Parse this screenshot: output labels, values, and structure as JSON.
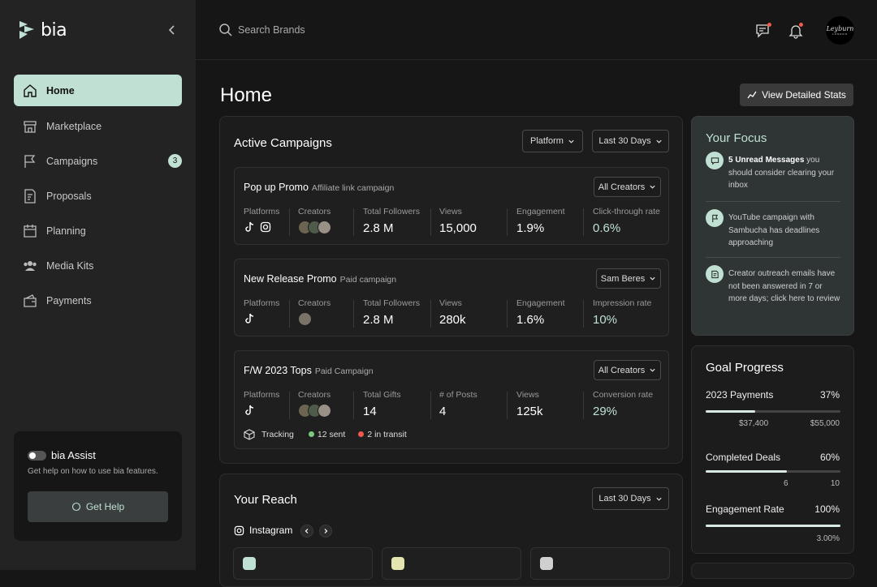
{
  "brand": {
    "name": "bia"
  },
  "sidebar": {
    "items": [
      {
        "label": "Home",
        "icon": "home-icon",
        "active": true
      },
      {
        "label": "Marketplace",
        "icon": "store-icon"
      },
      {
        "label": "Campaigns",
        "icon": "flag-icon",
        "badge": "3"
      },
      {
        "label": "Proposals",
        "icon": "document-edit-icon"
      },
      {
        "label": "Planning",
        "icon": "calendar-icon"
      },
      {
        "label": "Media Kits",
        "icon": "people-icon"
      },
      {
        "label": "Payments",
        "icon": "wallet-icon"
      }
    ],
    "assist": {
      "title": "bia Assist",
      "subtitle": "Get help on how to use bia features.",
      "button": "Get Help"
    }
  },
  "topbar": {
    "search_placeholder": "Search Brands",
    "avatar_text": "Leyburn",
    "avatar_sub": "LONDON"
  },
  "page": {
    "title": "Home",
    "stats_button": "View Detailed Stats"
  },
  "active_campaigns": {
    "title": "Active Campaigns",
    "filter_platform": "Platform",
    "filter_range": "Last 30 Days",
    "campaigns": [
      {
        "name": "Pop up Promo",
        "type": "Affiliate link campaign",
        "filter": "All Creators",
        "platforms_label": "Platforms",
        "creators_label": "Creators",
        "m1_label": "Total Followers",
        "m1_value": "2.8 M",
        "m2_label": "Views",
        "m2_value": "15,000",
        "m3_label": "Engagement",
        "m3_value": "1.9%",
        "m4_label": "Click-through rate",
        "m4_value": "0.6%"
      },
      {
        "name": "New Release Promo",
        "type": "Paid campaign",
        "filter": "Sam Beres",
        "platforms_label": "Platforms",
        "creators_label": "Creators",
        "m1_label": "Total Followers",
        "m1_value": "2.8 M",
        "m2_label": "Views",
        "m2_value": "280k",
        "m3_label": "Engagement",
        "m3_value": "1.6%",
        "m4_label": "Impression rate",
        "m4_value": "10%"
      },
      {
        "name": "F/W 2023 Tops",
        "type": "Paid Campaign",
        "filter": "All Creators",
        "platforms_label": "Platforms",
        "creators_label": "Creators",
        "m1_label": "Total Gifts",
        "m1_value": "14",
        "m2_label": "# of Posts",
        "m2_value": "4",
        "m3_label": "Views",
        "m3_value": "125k",
        "m4_label": "Conversion rate",
        "m4_value": "29%",
        "tracking": {
          "label": "Tracking",
          "sent": "12 sent",
          "transit": "2 in transit"
        }
      }
    ]
  },
  "reach": {
    "title": "Your Reach",
    "filter_range": "Last 30 Days",
    "platform": "Instagram"
  },
  "focus": {
    "title": "Your Focus",
    "items": [
      {
        "bold": "5 Unread Messages",
        "text": " you should consider clearing your inbox"
      },
      {
        "bold": "",
        "text": "YouTube campaign with Sambucha has deadlines approaching"
      },
      {
        "bold": "",
        "text": "Creator outreach emails have not been answered in 7 or more days; click here to review"
      }
    ]
  },
  "goals": {
    "title": "Goal Progress",
    "items": [
      {
        "label": "2023 Payments",
        "pct": "37%",
        "progress": 0.37,
        "left": "$37,400",
        "right": "$55,000"
      },
      {
        "label": "Completed Deals",
        "pct": "60%",
        "progress": 0.6,
        "left": "6",
        "right": "10"
      },
      {
        "label": "Engagement Rate",
        "pct": "100%",
        "progress": 1.0,
        "left": "",
        "right": "3.00%"
      }
    ]
  },
  "colors": {
    "accent": "#bfe0d2",
    "sent": "#7fc97f",
    "transit": "#f05a4c",
    "background": "#161616"
  }
}
